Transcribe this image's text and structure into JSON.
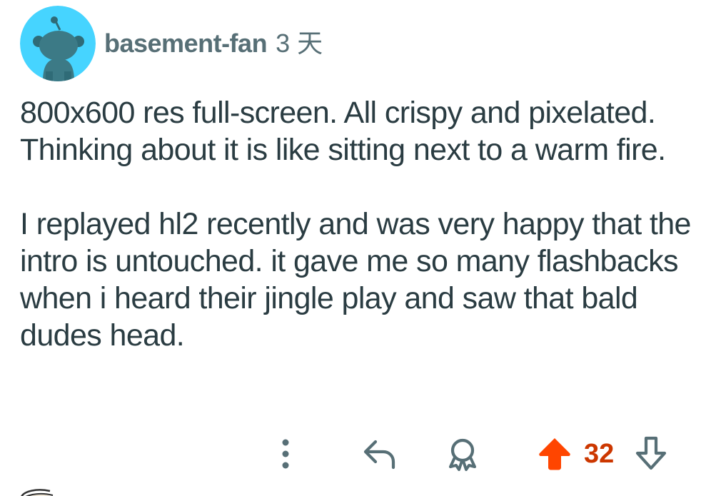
{
  "comment": {
    "username": "basement-fan",
    "age": "3 天",
    "avatar_icon": "snoo-avatar-icon",
    "avatar_color": "#46d4ff",
    "paragraphs": [
      "800x600 res full-screen. All crispy and pixelated. Thinking about it is like sitting next to a warm fire.",
      "I replayed hl2 recently and was very happy that the intro is untouched. it gave me so many flashbacks when i heard their jingle play and saw that bald dudes head."
    ]
  },
  "actions": {
    "more_icon": "more-vertical-icon",
    "reply_icon": "reply-icon",
    "award_icon": "award-icon",
    "upvote_icon": "upvote-arrow-icon",
    "upvote_state": "active",
    "upvote_color": "#ff4500",
    "score": "32",
    "score_color": "#cc3700",
    "downvote_icon": "downvote-arrow-icon"
  }
}
